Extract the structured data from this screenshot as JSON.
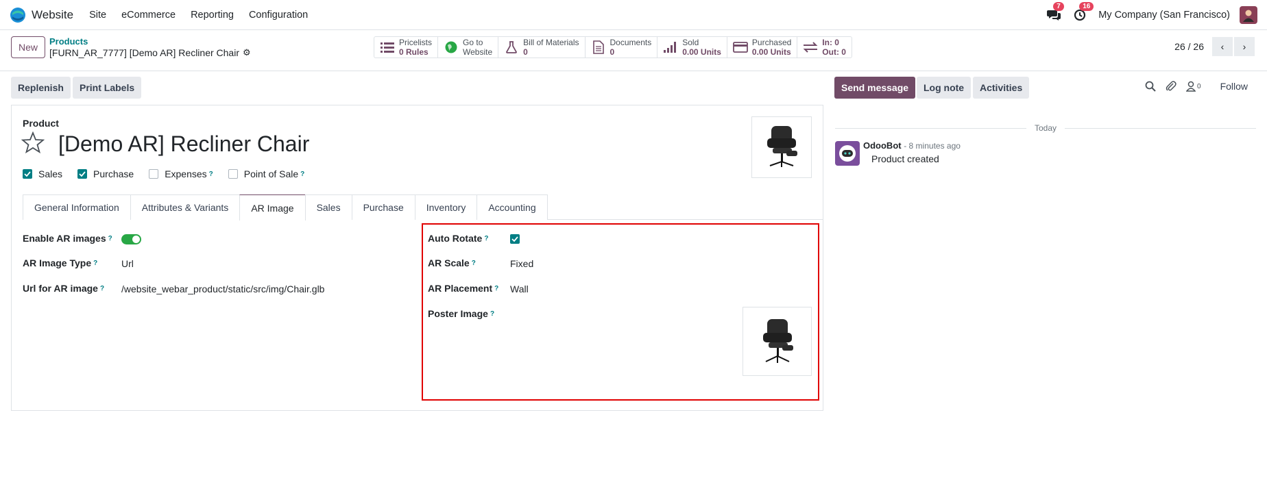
{
  "navbar": {
    "app_name": "Website",
    "menu": [
      "Site",
      "eCommerce",
      "Reporting",
      "Configuration"
    ],
    "messages_count": "7",
    "activities_count": "16",
    "company": "My Company (San Francisco)"
  },
  "control": {
    "new_label": "New",
    "breadcrumb_parent": "Products",
    "breadcrumb_current": "[FURN_AR_7777] [Demo AR] Recliner Chair",
    "smart_buttons": [
      {
        "icon": "list-icon",
        "line1": "Pricelists",
        "line2": "0 Rules"
      },
      {
        "icon": "globe-icon",
        "line1": "Go to",
        "line2": "Website"
      },
      {
        "icon": "flask-icon",
        "line1": "Bill of Materials",
        "line2": "0"
      },
      {
        "icon": "document-icon",
        "line1": "Documents",
        "line2": "0"
      },
      {
        "icon": "signal-icon",
        "line1": "Sold",
        "line2": "0.00 Units"
      },
      {
        "icon": "credit-card-icon",
        "line1": "Purchased",
        "line2": "0.00 Units"
      },
      {
        "icon": "exchange-icon",
        "line1": "In: 0",
        "line2": "Out: 0"
      }
    ],
    "pager": "26 / 26"
  },
  "actions": {
    "replenish": "Replenish",
    "print_labels": "Print Labels"
  },
  "product": {
    "type_label": "Product",
    "name": "[Demo AR] Recliner Chair",
    "checkboxes": [
      {
        "label": "Sales",
        "checked": true,
        "help": false
      },
      {
        "label": "Purchase",
        "checked": true,
        "help": false
      },
      {
        "label": "Expenses",
        "checked": false,
        "help": true
      },
      {
        "label": "Point of Sale",
        "checked": false,
        "help": true
      }
    ],
    "tabs": [
      "General Information",
      "Attributes & Variants",
      "AR Image",
      "Sales",
      "Purchase",
      "Inventory",
      "Accounting"
    ],
    "active_tab": "AR Image"
  },
  "ar": {
    "enable_label": "Enable AR images",
    "enable_value": true,
    "type_label": "AR Image Type",
    "type_value": "Url",
    "url_label": "Url for AR image",
    "url_value": "/website_webar_product/static/src/img/Chair.glb",
    "auto_rotate_label": "Auto Rotate",
    "auto_rotate_value": true,
    "scale_label": "AR Scale",
    "scale_value": "Fixed",
    "placement_label": "AR Placement",
    "placement_value": "Wall",
    "poster_label": "Poster Image",
    "help_mark": "?"
  },
  "chatter": {
    "send_message": "Send message",
    "log_note": "Log note",
    "activities": "Activities",
    "followers_count": "0",
    "follow": "Follow",
    "today": "Today",
    "author": "OdooBot",
    "time": "- 8 minutes ago",
    "body": "Product created"
  },
  "colors": {
    "brand": "#714b67",
    "accent": "#017e84",
    "highlight": "#e00000"
  }
}
